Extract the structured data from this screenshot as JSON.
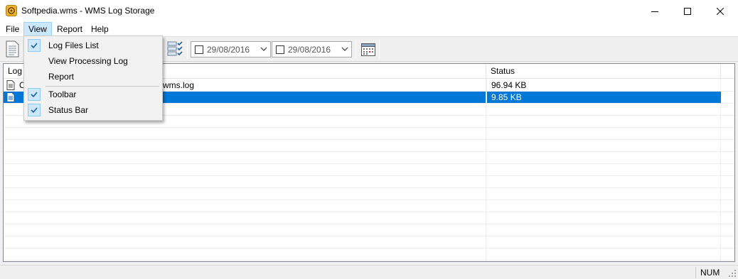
{
  "window": {
    "title": "Softpedia.wms - WMS Log Storage"
  },
  "menu": {
    "file": "File",
    "view": "View",
    "report": "Report",
    "help": "Help"
  },
  "view_menu": {
    "items": [
      {
        "label": "Log Files List",
        "checked": true
      },
      {
        "label": "View Processing Log",
        "checked": false
      },
      {
        "label": "Report",
        "checked": false
      },
      {
        "label": "Toolbar",
        "checked": true
      },
      {
        "label": "Status Bar",
        "checked": true
      }
    ]
  },
  "toolbar": {
    "date_from": "29/08/2016",
    "date_to": "29/08/2016"
  },
  "list": {
    "columns": {
      "log": "Log",
      "status": "Status"
    },
    "rows": [
      {
        "name": "O",
        "name_tail": "wms.log",
        "status": "96.94 KB",
        "selected": false
      },
      {
        "name": "",
        "name_tail": "",
        "status": "9.85 KB",
        "selected": true
      }
    ]
  },
  "statusbar": {
    "num": "NUM"
  },
  "colors": {
    "selection": "#0078d7",
    "menu_highlight": "#cce8ff",
    "accent_check": "#1a5fa8"
  }
}
